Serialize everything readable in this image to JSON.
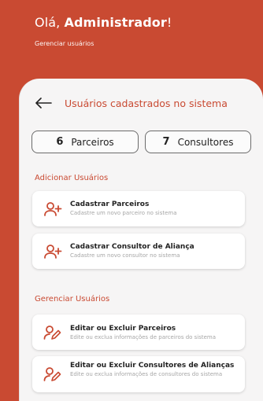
{
  "header": {
    "greeting_prefix": "Olá, ",
    "greeting_name": "Administrador",
    "greeting_suffix": "!",
    "subtitle": "Gerenciar usuários"
  },
  "page": {
    "title": "Usuários cadastrados no sistema"
  },
  "counters": {
    "parceiros": {
      "count": "6",
      "label": "Parceiros"
    },
    "consultores": {
      "count": "7",
      "label": "Consultores"
    }
  },
  "add_section": {
    "title": "Adicionar Usuários",
    "items": [
      {
        "title": "Cadastrar Parceiros",
        "description": "Cadastre um novo parceiro no sistema",
        "icon": "add-user-icon"
      },
      {
        "title": "Cadastrar Consultor de Aliança",
        "description": "Cadastre um novo consultor no sistema",
        "icon": "add-user-icon"
      }
    ]
  },
  "manage_section": {
    "title": "Gerenciar Usuários",
    "items": [
      {
        "title": "Editar ou Excluir Parceiros",
        "description": "Edite ou exclua informações de parceiros  do sistema",
        "icon": "edit-user-icon"
      },
      {
        "title": "Editar ou Excluir Consultores de Alianças",
        "description": "Edite ou exclua informações de consultores do sistema",
        "icon": "edit-user-icon"
      }
    ]
  },
  "colors": {
    "primary": "#c94a32",
    "background": "#f6f5f5",
    "card": "#ffffff"
  }
}
